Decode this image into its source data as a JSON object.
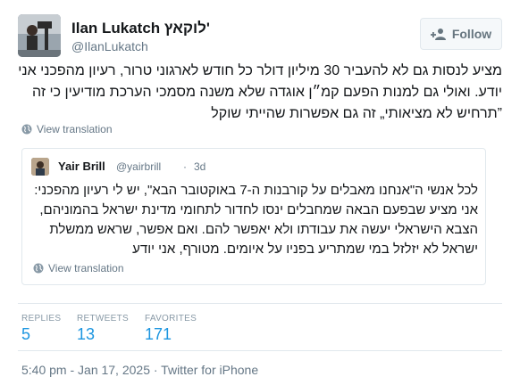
{
  "author": {
    "name": "Ilan Lukatch לוקאץ'",
    "handle": "@IlanLukatch"
  },
  "follow_button": {
    "label": "Follow",
    "icon": "add-user-icon"
  },
  "tweet": {
    "text": "מציע לנסות גם לא להעביר 30 מיליון דולר כל חודש לארגוני טרור, רעיון מהפכני אני יודע. ואולי גם למנות הפעם קמ״ן אוגדה שלא משנה מסמכי הערכת מודיעין כי זה ”תרחיש לא מציאותי„ זה גם אפשרות שהייתי שוקל",
    "view_translation": "View translation"
  },
  "quoted_tweet": {
    "name": "Yair Brill",
    "handle": "@yairbrill",
    "separator": "·",
    "time": "3d",
    "text": "לכל אנשי ה\"אנחנו מאבלים על קורבנות ה-7 באוקטובר הבא\", יש לי רעיון מהפכני: אני מציע שבפעם הבאה שמחבלים ינסו לחדור לתחומי מדינת ישראל בהמוניהם, הצבא הישראלי יעשה את עבודתו ולא יאפשר להם. ואם אפשר, שראש ממשלת ישראל לא יזלזל במי שמתריע בפניו על איומים. מטורף, אני יודע",
    "view_translation": "View translation"
  },
  "stats": [
    {
      "label": "REPLIES",
      "value": "5"
    },
    {
      "label": "RETWEETS",
      "value": "13"
    },
    {
      "label": "FAVORITES",
      "value": "171"
    }
  ],
  "footer": "5:40 pm - Jan 17, 2025 · Twitter for iPhone",
  "colors": {
    "accent": "#1b95e0",
    "muted": "#657786",
    "border": "#e1e8ed"
  }
}
